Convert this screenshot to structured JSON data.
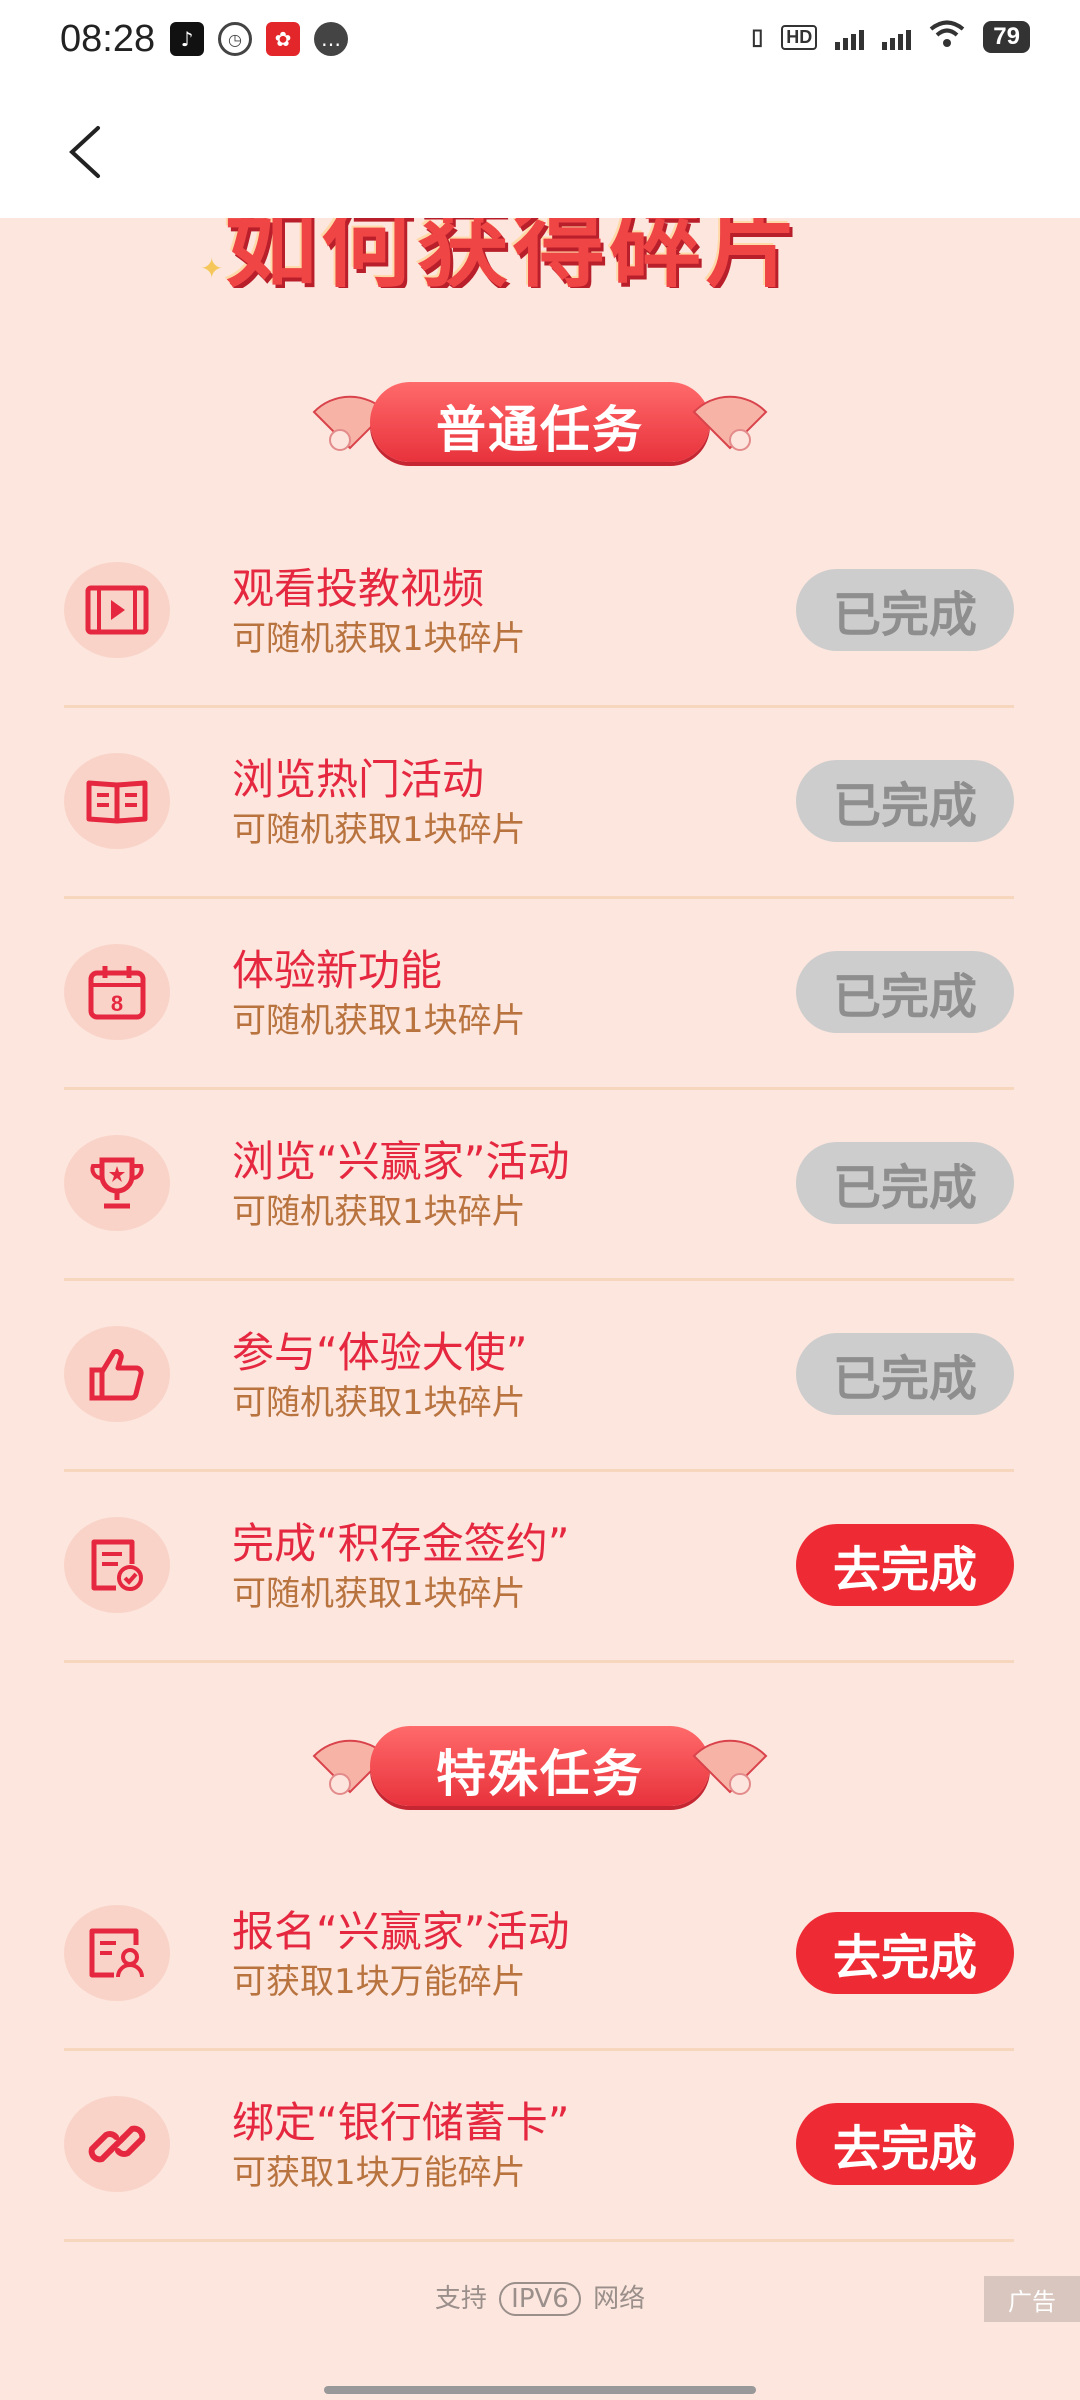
{
  "status_bar": {
    "time": "08:28",
    "battery": "79"
  },
  "banner": {
    "title": "如何获得碎片"
  },
  "sections": [
    {
      "title": "普通任务",
      "tasks": [
        {
          "icon": "video-icon",
          "name": "观看投教视频",
          "desc": "可随机获取1块碎片",
          "button": "已完成",
          "state": "done"
        },
        {
          "icon": "book-icon",
          "name": "浏览热门活动",
          "desc": "可随机获取1块碎片",
          "button": "已完成",
          "state": "done"
        },
        {
          "icon": "calendar-icon",
          "name": "体验新功能",
          "desc": "可随机获取1块碎片",
          "button": "已完成",
          "state": "done"
        },
        {
          "icon": "trophy-icon",
          "name": "浏览“兴赢家”活动",
          "desc": "可随机获取1块碎片",
          "button": "已完成",
          "state": "done"
        },
        {
          "icon": "thumbs-up-icon",
          "name": "参与“体验大使”",
          "desc": "可随机获取1块碎片",
          "button": "已完成",
          "state": "done"
        },
        {
          "icon": "contract-icon",
          "name": "完成“积存金签约”",
          "desc": "可随机获取1块碎片",
          "button": "去完成",
          "state": "todo"
        }
      ]
    },
    {
      "title": "特殊任务",
      "tasks": [
        {
          "icon": "register-icon",
          "name": "报名“兴赢家”活动",
          "desc": "可获取1块万能碎片",
          "button": "去完成",
          "state": "todo"
        },
        {
          "icon": "link-icon",
          "name": "绑定“银行储蓄卡”",
          "desc": "可获取1块万能碎片",
          "button": "去完成",
          "state": "todo"
        }
      ]
    }
  ],
  "footer": {
    "support": "支持",
    "ipv6": "IPV6",
    "network": "网络",
    "ad": "广告"
  },
  "colors": {
    "background": "#fce6de",
    "accent": "#ee2a34",
    "done_button": "#cdcdcd"
  }
}
